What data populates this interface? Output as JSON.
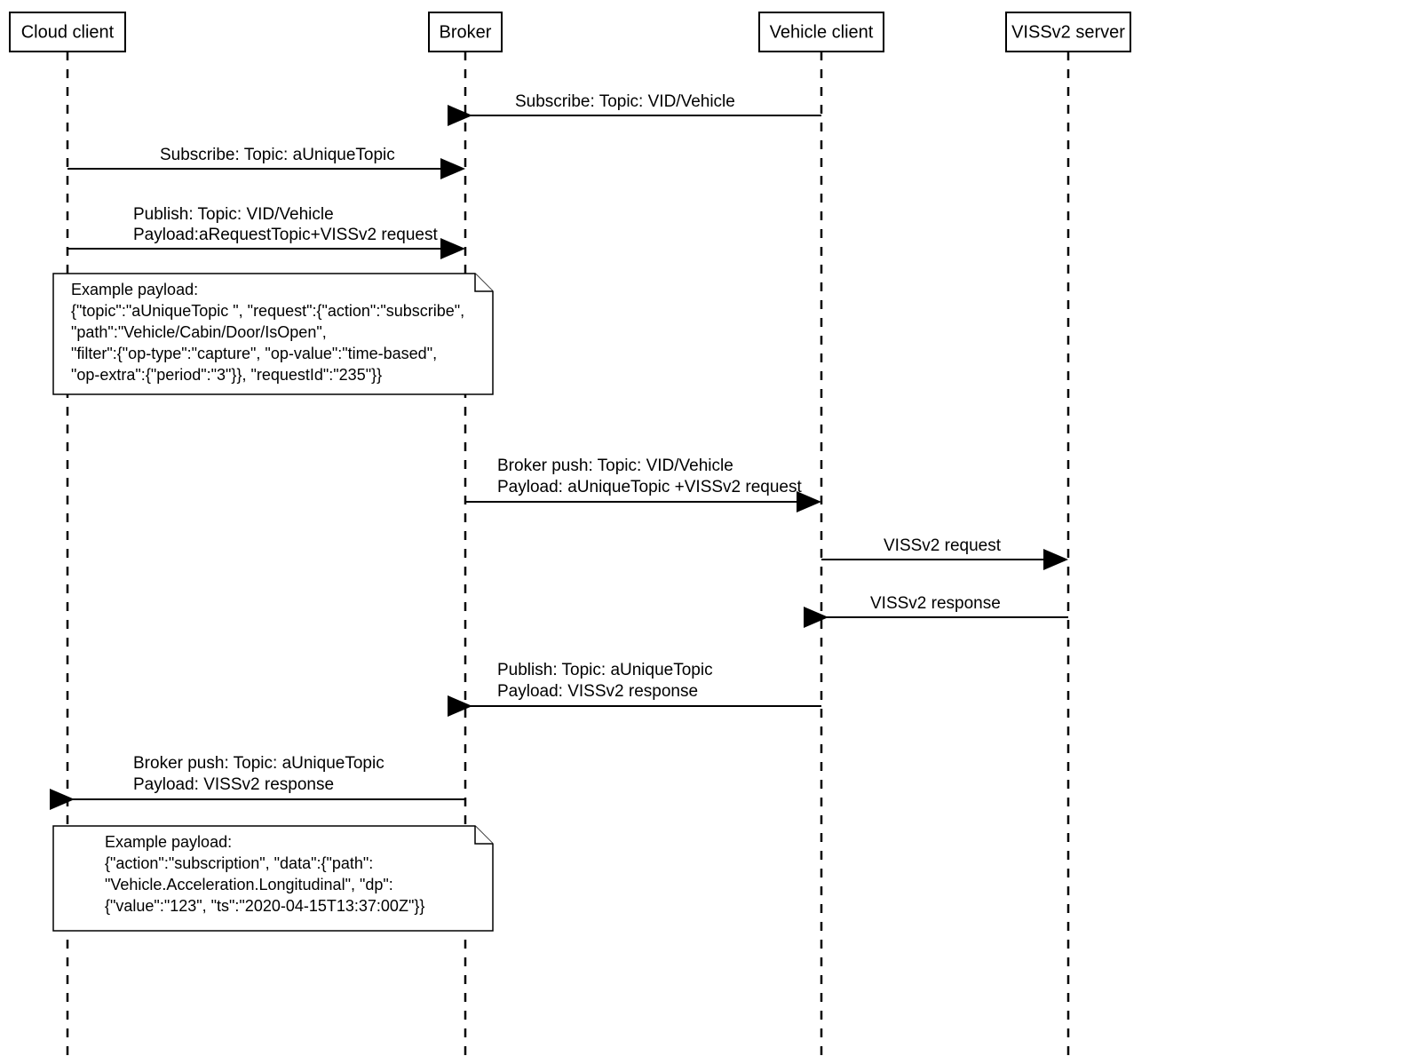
{
  "actors": {
    "cloud": "Cloud client",
    "broker": "Broker",
    "vehicle": "Vehicle client",
    "server": "VISSv2 server"
  },
  "messages": {
    "m1": {
      "label": "Subscribe: Topic: ",
      "topic": "VID/Vehicle"
    },
    "m2": {
      "label": "Subscribe: Topic: ",
      "topic": "aUniqueTopic"
    },
    "m3": {
      "line1a": "Publish: Topic: ",
      "line1b": "VID/Vehicle",
      "line2": "Payload:aRequestTopic+VISSv2 request"
    },
    "m4": {
      "line1a": "Broker push: Topic: ",
      "line1b": "VID/Vehicle",
      "line2a": "Payload: ",
      "line2b": "aUniqueTopic ",
      "line2c": "+VISSv2 request"
    },
    "m5": "VISSv2 request",
    "m6": "VISSv2 response",
    "m7": {
      "line1a": "Publish: Topic: ",
      "line1b": "aUniqueTopic",
      "line2a": "Payload: ",
      "line2b": "VISSv2 response"
    },
    "m8": {
      "line1a": "Broker push: Topic: ",
      "line1b": "aUniqueTopic",
      "line2a": "Payload: ",
      "line2b": "VISSv2 response"
    }
  },
  "notes": {
    "n1": {
      "title": "Example payload:",
      "l1a": "{\"topic\":\"",
      "l1b": "aUniqueTopic ",
      "l1c": "\", \"request\":{\"action\":\"subscribe\",",
      "l2": " \"path\":\"Vehicle/Cabin/Door/IsOpen\",",
      "l3": " \"filter\":{\"op-type\":\"capture\", \"op-value\":\"time-based\",",
      "l4": " \"op-extra\":{\"period\":\"3\"}}, \"requestId\":\"235\"}}"
    },
    "n2": {
      "title": "Example payload:",
      "l1": "{\"action\":\"subscription\", \"data\":{\"path\":",
      "l2": " \"Vehicle.Acceleration.Longitudinal\", \"dp\":",
      "l3": " {\"value\":\"123\", \"ts\":\"2020-04-15T13:37:00Z\"}}"
    }
  }
}
